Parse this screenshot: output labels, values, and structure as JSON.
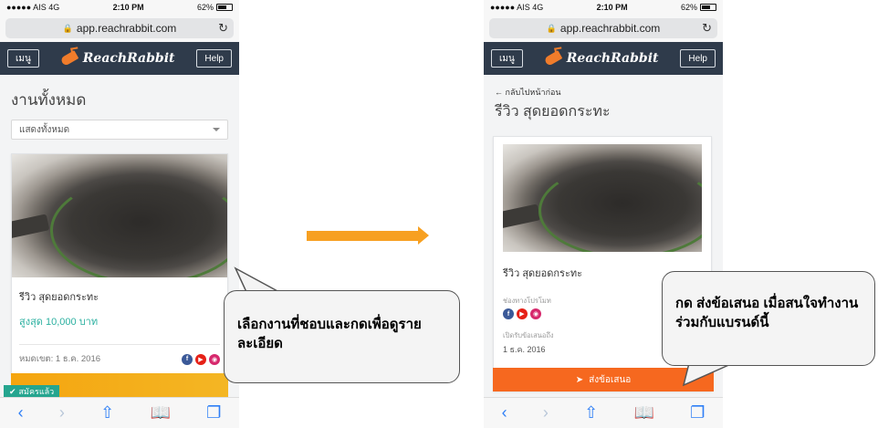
{
  "left_phone": {
    "status": {
      "carrier": "●●●●● AIS  4G",
      "time": "2:10 PM",
      "battery": "62%"
    },
    "url": "app.reachrabbit.com",
    "appbar": {
      "menu_label": "เมนู",
      "brand": "ReachRabbit",
      "help_label": "Help"
    },
    "page_title": "งานทั้งหมด",
    "filter": {
      "selected": "แสดงทั้งหมด"
    },
    "card": {
      "title": "รีวิว สุดยอดกระทะ",
      "price": "สูงสุด 10,000 บาท",
      "deadline": "หมดเขต: 1 ธ.ค. 2016"
    },
    "registered_tag": "สมัครแล้ว"
  },
  "right_phone": {
    "status": {
      "carrier": "●●●●● AIS  4G",
      "time": "2:10 PM",
      "battery": "62%"
    },
    "url": "app.reachrabbit.com",
    "appbar": {
      "menu_label": "เมนู",
      "brand": "ReachRabbit",
      "help_label": "Help"
    },
    "back_link": "กลับไปหน้าก่อน",
    "page_title": "รีวิว สุดยอดกระทะ",
    "card": {
      "title": "รีวิว สุดยอดกระทะ",
      "channels_label": "ช่องทางโปรโมท",
      "offer_label": "เปิดรับข้อเสนอถึง",
      "deadline": "1 ธ.ค. 2016"
    },
    "send_button": "ส่งข้อเสนอ"
  },
  "callouts": {
    "left": "เลือกงานที่ชอบและกดเพื่อดูรายละเอียด",
    "right": "กด ส่งข้อเสนอ เมื่อสนใจทำงานร่วมกับแบรนด์นี้"
  },
  "colors": {
    "navbar": "#2f3b4b",
    "accent_orange": "#f6681f",
    "price_teal": "#2bb0a0",
    "arrow": "#f7a021"
  }
}
